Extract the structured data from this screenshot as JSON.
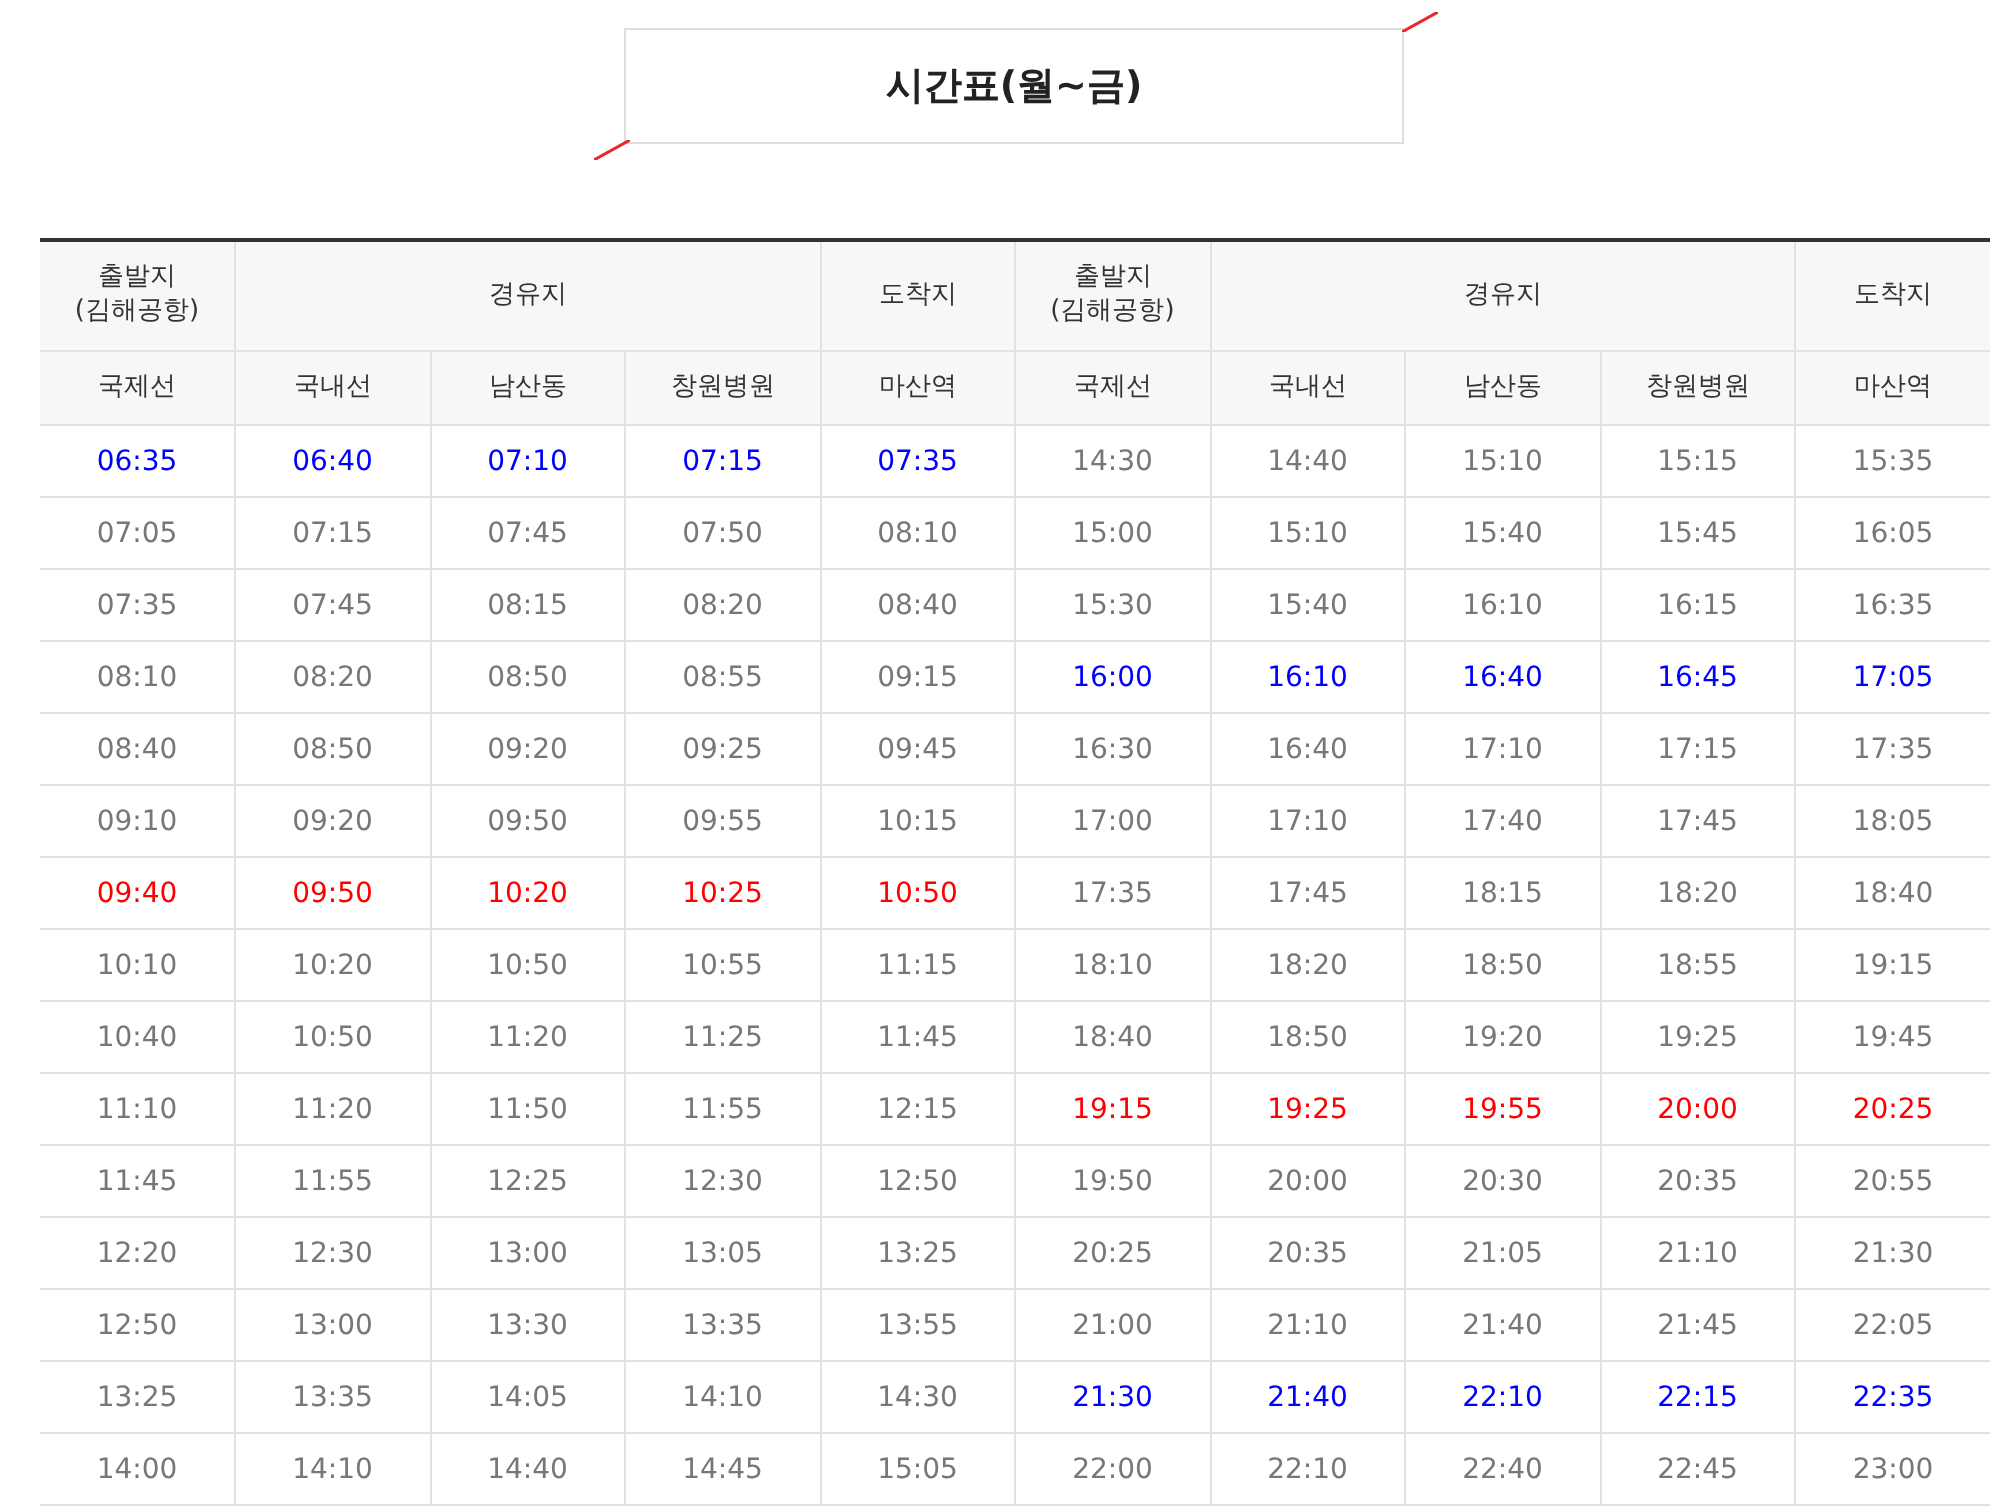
{
  "title": "시간표(월~금)",
  "header": {
    "groups": [
      {
        "kind": "origin",
        "label": "출발지",
        "sublabel": "(김해공항)"
      },
      {
        "kind": "via",
        "label": "경유지"
      },
      {
        "kind": "destination",
        "label": "도착지"
      },
      {
        "kind": "origin",
        "label": "출발지",
        "sublabel": "(김해공항)"
      },
      {
        "kind": "via",
        "label": "경유지"
      },
      {
        "kind": "destination",
        "label": "도착지"
      }
    ],
    "columns": [
      "국제선",
      "국내선",
      "남산동",
      "창원병원",
      "마산역",
      "국제선",
      "국내선",
      "남산동",
      "창원병원",
      "마산역"
    ]
  },
  "rows": [
    {
      "left": {
        "color": "#0000ff",
        "times": [
          "06:35",
          "06:40",
          "07:10",
          "07:15",
          "07:35"
        ]
      },
      "right": {
        "color": "#777777",
        "times": [
          "14:30",
          "14:40",
          "15:10",
          "15:15",
          "15:35"
        ]
      }
    },
    {
      "left": {
        "color": "#777777",
        "times": [
          "07:05",
          "07:15",
          "07:45",
          "07:50",
          "08:10"
        ]
      },
      "right": {
        "color": "#777777",
        "times": [
          "15:00",
          "15:10",
          "15:40",
          "15:45",
          "16:05"
        ]
      }
    },
    {
      "left": {
        "color": "#777777",
        "times": [
          "07:35",
          "07:45",
          "08:15",
          "08:20",
          "08:40"
        ]
      },
      "right": {
        "color": "#777777",
        "times": [
          "15:30",
          "15:40",
          "16:10",
          "16:15",
          "16:35"
        ]
      }
    },
    {
      "left": {
        "color": "#777777",
        "times": [
          "08:10",
          "08:20",
          "08:50",
          "08:55",
          "09:15"
        ]
      },
      "right": {
        "color": "#0000ff",
        "times": [
          "16:00",
          "16:10",
          "16:40",
          "16:45",
          "17:05"
        ]
      }
    },
    {
      "left": {
        "color": "#777777",
        "times": [
          "08:40",
          "08:50",
          "09:20",
          "09:25",
          "09:45"
        ]
      },
      "right": {
        "color": "#777777",
        "times": [
          "16:30",
          "16:40",
          "17:10",
          "17:15",
          "17:35"
        ]
      }
    },
    {
      "left": {
        "color": "#777777",
        "times": [
          "09:10",
          "09:20",
          "09:50",
          "09:55",
          "10:15"
        ]
      },
      "right": {
        "color": "#777777",
        "times": [
          "17:00",
          "17:10",
          "17:40",
          "17:45",
          "18:05"
        ]
      }
    },
    {
      "left": {
        "color": "#ff0000",
        "times": [
          "09:40",
          "09:50",
          "10:20",
          "10:25",
          "10:50"
        ]
      },
      "right": {
        "color": "#777777",
        "times": [
          "17:35",
          "17:45",
          "18:15",
          "18:20",
          "18:40"
        ]
      }
    },
    {
      "left": {
        "color": "#777777",
        "times": [
          "10:10",
          "10:20",
          "10:50",
          "10:55",
          "11:15"
        ]
      },
      "right": {
        "color": "#777777",
        "times": [
          "18:10",
          "18:20",
          "18:50",
          "18:55",
          "19:15"
        ]
      }
    },
    {
      "left": {
        "color": "#777777",
        "times": [
          "10:40",
          "10:50",
          "11:20",
          "11:25",
          "11:45"
        ]
      },
      "right": {
        "color": "#777777",
        "times": [
          "18:40",
          "18:50",
          "19:20",
          "19:25",
          "19:45"
        ]
      }
    },
    {
      "left": {
        "color": "#777777",
        "times": [
          "11:10",
          "11:20",
          "11:50",
          "11:55",
          "12:15"
        ]
      },
      "right": {
        "color": "#ff0000",
        "times": [
          "19:15",
          "19:25",
          "19:55",
          "20:00",
          "20:25"
        ]
      }
    },
    {
      "left": {
        "color": "#777777",
        "times": [
          "11:45",
          "11:55",
          "12:25",
          "12:30",
          "12:50"
        ]
      },
      "right": {
        "color": "#777777",
        "times": [
          "19:50",
          "20:00",
          "20:30",
          "20:35",
          "20:55"
        ]
      }
    },
    {
      "left": {
        "color": "#777777",
        "times": [
          "12:20",
          "12:30",
          "13:00",
          "13:05",
          "13:25"
        ]
      },
      "right": {
        "color": "#777777",
        "times": [
          "20:25",
          "20:35",
          "21:05",
          "21:10",
          "21:30"
        ]
      }
    },
    {
      "left": {
        "color": "#777777",
        "times": [
          "12:50",
          "13:00",
          "13:30",
          "13:35",
          "13:55"
        ]
      },
      "right": {
        "color": "#777777",
        "times": [
          "21:00",
          "21:10",
          "21:40",
          "21:45",
          "22:05"
        ]
      }
    },
    {
      "left": {
        "color": "#777777",
        "times": [
          "13:25",
          "13:35",
          "14:05",
          "14:10",
          "14:30"
        ]
      },
      "right": {
        "color": "#0000ff",
        "times": [
          "21:30",
          "21:40",
          "22:10",
          "22:15",
          "22:35"
        ]
      }
    },
    {
      "left": {
        "color": "#777777",
        "times": [
          "14:00",
          "14:10",
          "14:40",
          "14:45",
          "15:05"
        ]
      },
      "right": {
        "color": "#777777",
        "times": [
          "22:00",
          "22:10",
          "22:40",
          "22:45",
          "23:00"
        ]
      }
    }
  ]
}
